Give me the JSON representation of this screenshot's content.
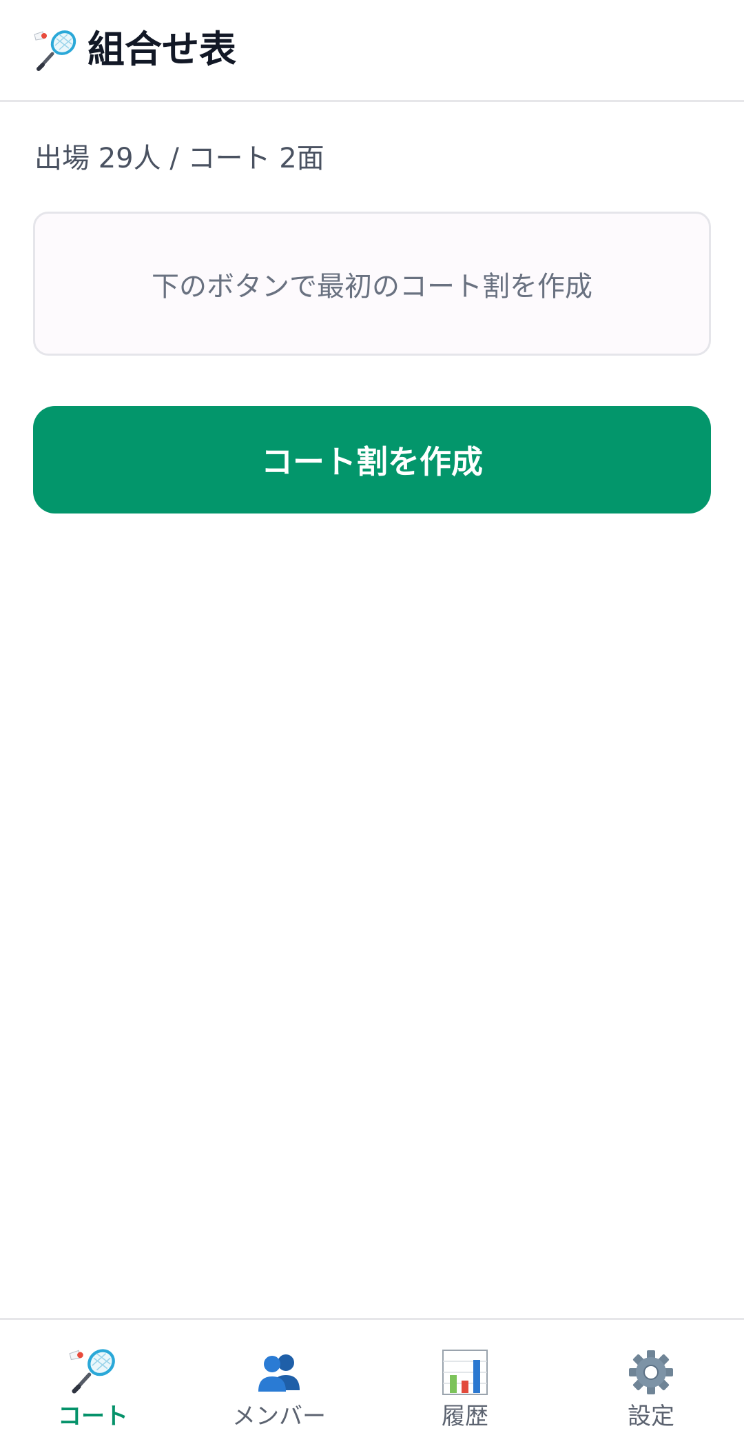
{
  "header": {
    "title": "組合せ表",
    "icon": "badminton-icon"
  },
  "summary": {
    "text": "出場 29人 / コート 2面"
  },
  "empty_state": {
    "message": "下のボタンで最初のコート割を作成"
  },
  "primary_action": {
    "label": "コート割を作成"
  },
  "bottom_nav": {
    "items": [
      {
        "label": "コート",
        "icon": "badminton-icon",
        "active": true
      },
      {
        "label": "メンバー",
        "icon": "people-icon",
        "active": false
      },
      {
        "label": "履歴",
        "icon": "bar-chart-icon",
        "active": false
      },
      {
        "label": "設定",
        "icon": "gear-icon",
        "active": false
      }
    ]
  },
  "colors": {
    "accent": "#03966b",
    "active_tab": "#05926a",
    "title": "#121826",
    "muted_text": "#697180"
  }
}
